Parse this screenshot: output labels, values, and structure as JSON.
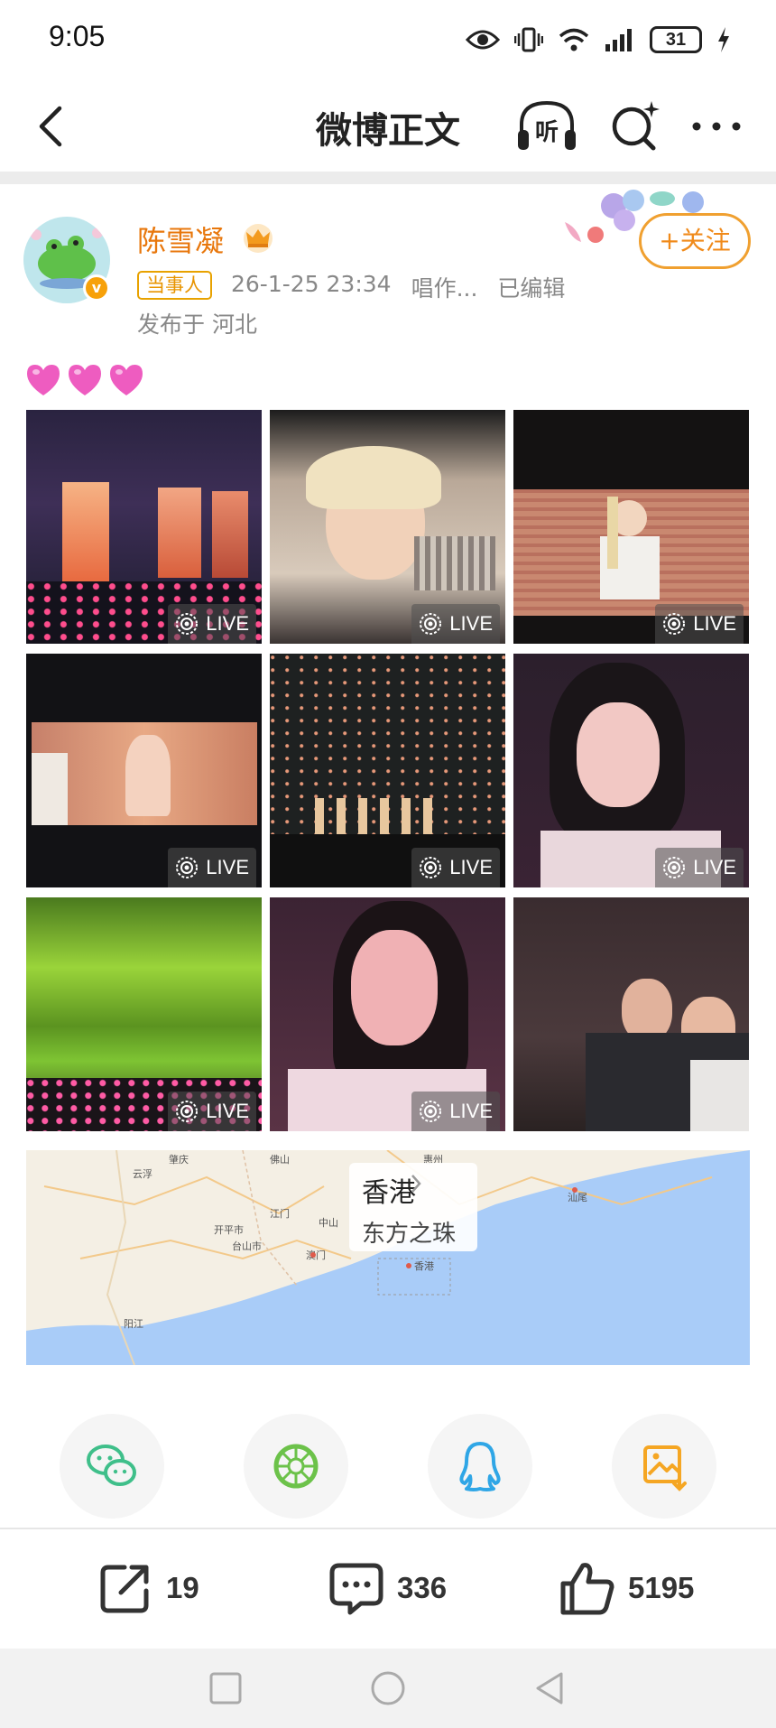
{
  "status_bar": {
    "time": "9:05",
    "battery_level": "31",
    "icons": [
      "eye-icon",
      "vibrate-icon",
      "wifi-icon",
      "signal-icon",
      "battery-icon",
      "charging-icon"
    ]
  },
  "header": {
    "title": "微博正文",
    "listen_label": "听",
    "icons": [
      "back-icon",
      "listen-icon",
      "ai-search-icon",
      "more-icon"
    ]
  },
  "post": {
    "author": {
      "name": "陈雪凝",
      "role_badge": "当事人",
      "verified_icon": "verified-icon",
      "crown_icon": "crown-icon"
    },
    "timestamp": "26-1-25 23:34",
    "source": "唱作...",
    "edited": "已编辑",
    "location": "发布于 河北",
    "follow_label": "+关注",
    "content_emoji": [
      "💗",
      "💗",
      "💗"
    ],
    "photos": [
      {
        "live": true,
        "label": "LIVE",
        "scene": "concert-stage"
      },
      {
        "live": true,
        "label": "LIVE",
        "scene": "screen-closeup"
      },
      {
        "live": true,
        "label": "LIVE",
        "scene": "screen-singer"
      },
      {
        "live": true,
        "label": "LIVE",
        "scene": "screen-performance"
      },
      {
        "live": true,
        "label": "LIVE",
        "scene": "dancers-stage"
      },
      {
        "live": true,
        "label": "LIVE",
        "scene": "selfie-1"
      },
      {
        "live": true,
        "label": "LIVE",
        "scene": "laser-show"
      },
      {
        "live": true,
        "label": "LIVE",
        "scene": "selfie-2"
      },
      {
        "live": false,
        "label": "",
        "scene": "crowd-group"
      }
    ],
    "map": {
      "city": "香港",
      "poi": "东方之珠",
      "place_labels": [
        "肇庆",
        "云浮",
        "佛山",
        "江门",
        "中山",
        "开平市",
        "台山市",
        "澳门",
        "香港",
        "阳江",
        "汕尾",
        "惠州"
      ]
    }
  },
  "share": {
    "targets": [
      "wechat-icon",
      "moments-icon",
      "qq-icon",
      "save-image-icon"
    ]
  },
  "actions": {
    "reposts": "19",
    "comments": "336",
    "likes": "5195"
  },
  "colors": {
    "accent_orange": "#f08a1a",
    "author_name": "#e8770c",
    "wechat_green": "#3fbf8a",
    "moments_green": "#6cc24a",
    "qq_blue": "#2fa6e6",
    "save_orange": "#f5a623",
    "map_water": "#a9ccf8"
  }
}
